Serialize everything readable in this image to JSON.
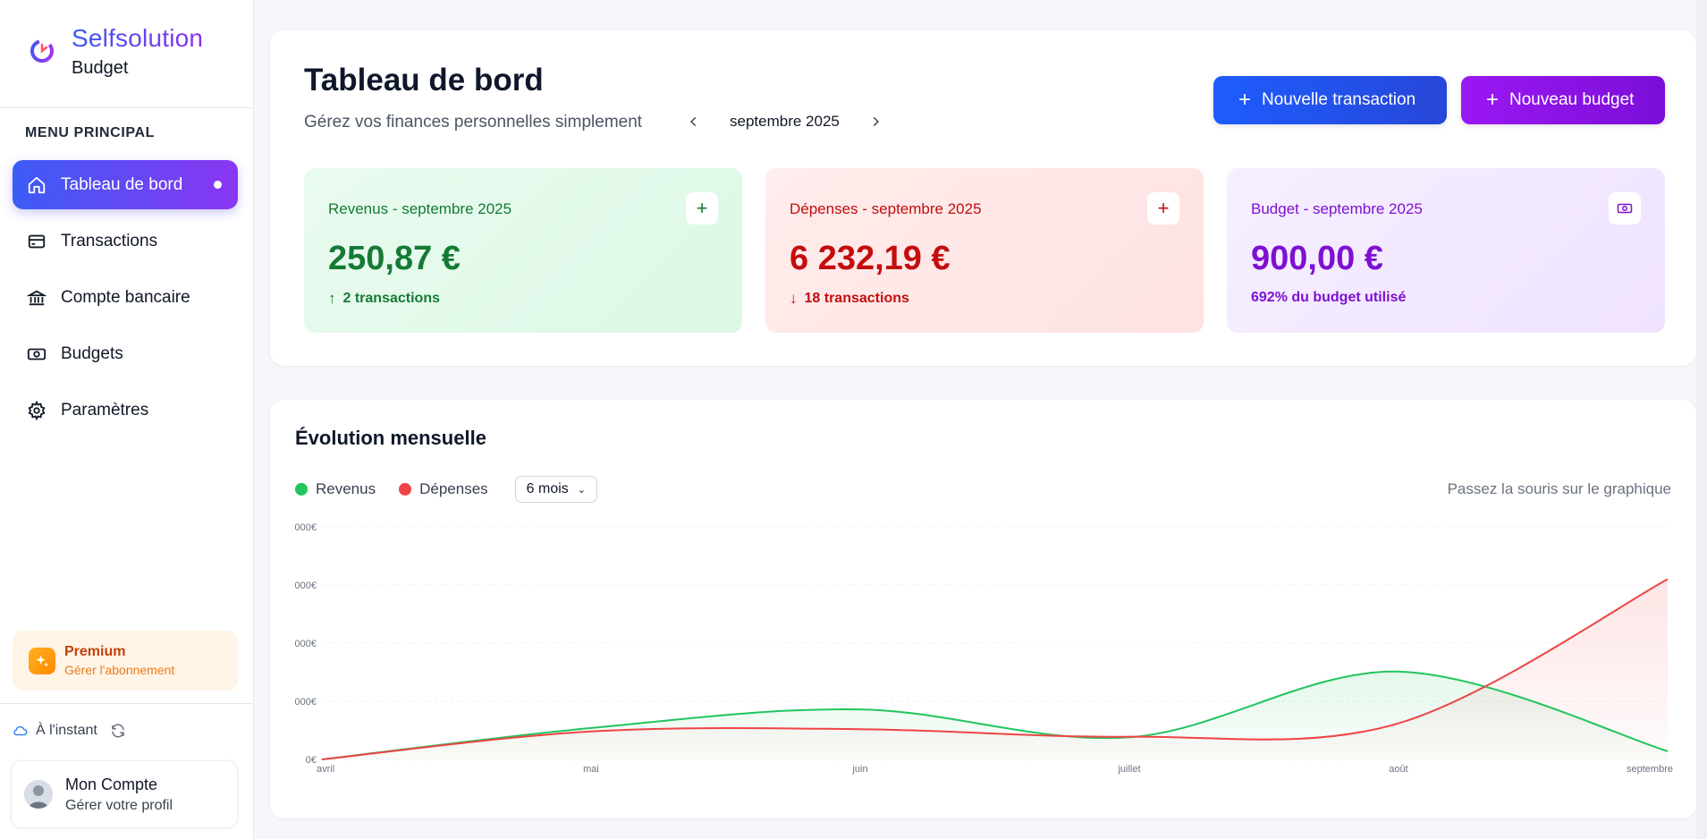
{
  "brand": {
    "name": "Selfsolution",
    "sub": "Budget"
  },
  "menu": {
    "title": "MENU PRINCIPAL",
    "items": [
      {
        "label": "Tableau de bord",
        "icon": "home-icon",
        "active": true
      },
      {
        "label": "Transactions",
        "icon": "card-icon"
      },
      {
        "label": "Compte bancaire",
        "icon": "bank-icon"
      },
      {
        "label": "Budgets",
        "icon": "banknote-icon"
      },
      {
        "label": "Paramètres",
        "icon": "gear-icon"
      }
    ]
  },
  "premium": {
    "title": "Premium",
    "sub": "Gérer l'abonnement"
  },
  "sync": {
    "label": "À l'instant"
  },
  "account": {
    "title": "Mon Compte",
    "sub": "Gérer votre profil"
  },
  "header": {
    "title": "Tableau de bord",
    "subtitle": "Gérez vos finances personnelles simplement",
    "month": "septembre 2025",
    "btn_transaction": "Nouvelle transaction",
    "btn_budget": "Nouveau budget"
  },
  "stats": {
    "income": {
      "label": "Revenus - septembre 2025",
      "value": "250,87 €",
      "foot": "2 transactions",
      "color": "#157a35"
    },
    "expenses": {
      "label": "Dépenses - septembre 2025",
      "value": "6 232,19 €",
      "foot": "18 transactions",
      "color": "#c40d0d"
    },
    "budget": {
      "label": "Budget - septembre 2025",
      "value": "900,00 €",
      "foot": "692% du budget utilisé",
      "color": "#7e10d2"
    }
  },
  "chart": {
    "title": "Évolution mensuelle",
    "legend_income": "Revenus",
    "legend_expenses": "Dépenses",
    "period": "6 mois",
    "hint": "Passez la souris sur le graphique"
  },
  "chart_data": {
    "type": "area",
    "title": "Évolution mensuelle",
    "categories": [
      "avril",
      "mai",
      "juin",
      "juillet",
      "août",
      "septembre"
    ],
    "y_tick_labels": [
      "0€",
      "000€",
      "000€",
      "000€",
      "000€"
    ],
    "series": [
      {
        "name": "Revenus",
        "color": "#22c55e",
        "values": [
          0,
          540,
          860,
          380,
          1510,
          140
        ]
      },
      {
        "name": "Dépenses",
        "color": "#ef4444",
        "values": [
          0,
          480,
          520,
          390,
          620,
          3100
        ]
      }
    ],
    "ylim": [
      0,
      4000
    ],
    "grid": true
  }
}
